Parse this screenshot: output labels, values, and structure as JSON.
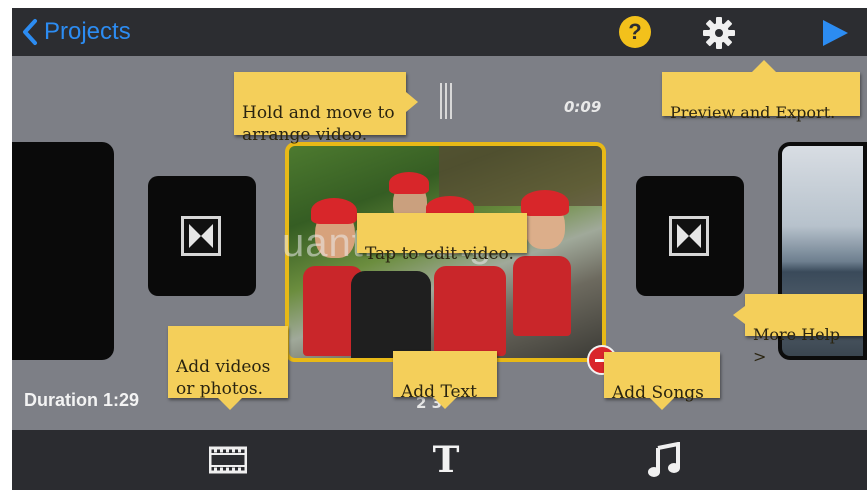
{
  "nav": {
    "back_label": "Projects",
    "help_label": "?"
  },
  "timeline": {
    "current_time": "0:09",
    "duration": "Duration 1:29",
    "peek_label": "2 3"
  },
  "tips": {
    "hold_move": "Hold and move to\narrange video.",
    "preview_export": "Preview and Export.",
    "tap_edit": "Tap to edit video.",
    "more_help": "More Help >",
    "add_videos": "Add videos\nor photos.",
    "add_text": "Add Text",
    "add_songs": "Add Songs"
  },
  "toolbar": {
    "text_tool_label": "T"
  },
  "watermark": "uantrimang",
  "colors": {
    "accent_blue": "#2c8cf2",
    "help_yellow": "#f3c11b",
    "selection_border": "#e8b917",
    "note_yellow": "#f4cf5a",
    "delete_red": "#d9262b",
    "bar_dark": "#2c2d31",
    "workspace_gray": "#7d7f86"
  },
  "icons": {
    "back": "chevron-left-icon",
    "help": "question-circle-icon",
    "settings": "gear-icon",
    "preview": "play-icon",
    "transition": "bowtie-transition-icon",
    "delete": "minus-circle-icon",
    "video": "film-strip-icon",
    "text": "text-T-icon",
    "music": "music-note-icon"
  }
}
